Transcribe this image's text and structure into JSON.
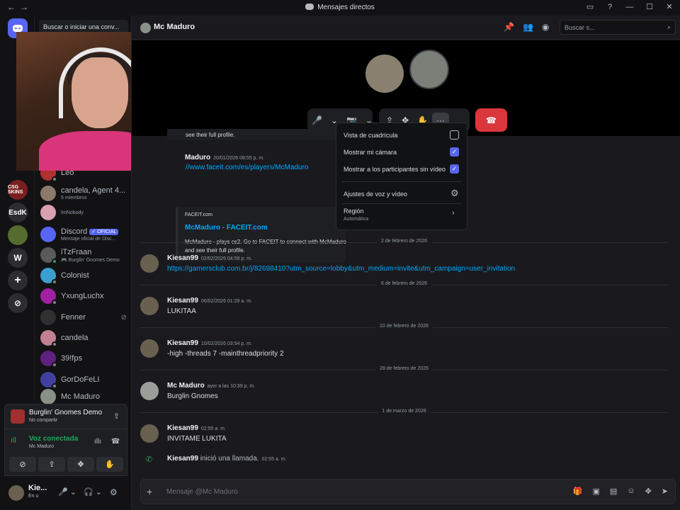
{
  "titlebar": {
    "nav_back": "←",
    "nav_forward": "→",
    "title": "Mensajes directos",
    "controls": [
      "—",
      "☐",
      "✕"
    ]
  },
  "guilds": [
    {
      "label": "CSG SKINS",
      "color": "#7a1f1f"
    },
    {
      "label": "EsdK",
      "color": "#2b2d31"
    },
    {
      "label": "",
      "color": "#556b2f"
    },
    {
      "label": "W",
      "color": "#2b2d31"
    },
    {
      "label": "+",
      "color": "#2b2d31"
    },
    {
      "label": "⊘",
      "color": "#2b2d31"
    }
  ],
  "sidebar": {
    "search_label": "Buscar o iniciar una conv...",
    "dms": [
      {
        "name": "Leo",
        "sub": "",
        "color": "#b03030"
      },
      {
        "name": "candela, Agent 4...",
        "sub": "5 miembros",
        "color": "#8a7a6a"
      },
      {
        "name": "",
        "sub": "ImNobody",
        "color": "#d8a0b0"
      },
      {
        "name": "Discord",
        "badge": "✓ OFICIAL",
        "sub": "Mensaje oficial de Disc...",
        "color": "#5865f2"
      },
      {
        "name": "iTzFraan",
        "sub": "🎮 Burglin' Gnomes Demo",
        "color": "#5a5a5a"
      },
      {
        "name": "Colonist",
        "sub": "",
        "color": "#3aa0d0"
      },
      {
        "name": "YxungLuchx",
        "sub": "",
        "color": "#a020a0"
      },
      {
        "name": "Fenner",
        "sub": "",
        "color": "#303030"
      },
      {
        "name": "candela",
        "sub": "",
        "color": "#c08090"
      },
      {
        "name": "39!fps",
        "sub": "",
        "color": "#602080"
      },
      {
        "name": "GorDoFeLI",
        "sub": "",
        "color": "#4040a0"
      },
      {
        "name": "Mc Maduro",
        "sub": "",
        "color": "#8a8f88"
      }
    ]
  },
  "panel": {
    "activity_title": "Burglin' Gnomes Demo",
    "activity_sub": "No compartir",
    "voice_status": "Voz conectada",
    "voice_channel": "Mc Maduro",
    "user_name": "Kie...",
    "user_status": "En u"
  },
  "header": {
    "name": "Mc Maduro",
    "search_placeholder": "Buscar s..."
  },
  "call": {
    "controls": [
      "🎤",
      "⌄",
      "📷",
      "⌄",
      "⇪",
      "✥",
      "✋",
      "···"
    ],
    "hangup": "☎"
  },
  "menu": {
    "items": [
      {
        "label": "Vista de cuadrícula",
        "checked": false
      },
      {
        "label": "Mostrar mi cámara",
        "checked": true
      },
      {
        "label": "Mostrar a los participantes sin vídeo",
        "checked": true
      }
    ],
    "voice_settings": "Ajustes de voz y vídeo",
    "region_label": "Región",
    "region_value": "Automática"
  },
  "messages": {
    "partial_top": "see their full profile.",
    "first": {
      "author": "Maduro",
      "time": "20/01/2026 08:55 p. m.",
      "link": "//www.faceit.com/es/players/McMaduro",
      "embed": {
        "provider": "FACEIT.com",
        "title": "McMaduro - FACEIT.com",
        "description": "McMaduro - plays cs2. Go to FACEIT to connect with McMaduro and see their full profile."
      }
    },
    "list": [
      {
        "date": "2 de febrero de 2026",
        "author": "Kiesan99",
        "time": "02/02/2026 04:59 p. m.",
        "body": "https://gamersclub.com.br/j/82698410?utm_source=lobby&utm_medium=invite&utm_campaign=user_invitation",
        "is_link": true,
        "av": "#6a6050"
      },
      {
        "date": "6 de febrero de 2026",
        "author": "Kiesan99",
        "time": "06/02/2026 01:29 a. m.",
        "body": "LUKITAA",
        "is_link": false,
        "av": "#6a6050"
      },
      {
        "date": "10 de febrero de 2026",
        "author": "Kiesan99",
        "time": "10/02/2026 03:54 p. m.",
        "body": "-high -threads 7 -mainthreadpriority 2",
        "is_link": false,
        "av": "#6a6050"
      },
      {
        "date": "28 de febrero de 2026",
        "author": "Mc Maduro",
        "time": "ayer a las 10:39 p. m.",
        "body": "Burglin Gnomes",
        "is_link": false,
        "av": "#9a9e98"
      },
      {
        "date": "1 de marzo de 2026",
        "author": "Kiesan99",
        "time": "02:55 a. m.",
        "body": "INVITAME LUKITA",
        "is_link": false,
        "av": "#6a6050"
      }
    ],
    "call_event": {
      "author": "Kiesan99",
      "text": "inició una llamada.",
      "time": "02:55 a. m."
    }
  },
  "composer": {
    "placeholder": "Mensaje @Mc Maduro"
  }
}
